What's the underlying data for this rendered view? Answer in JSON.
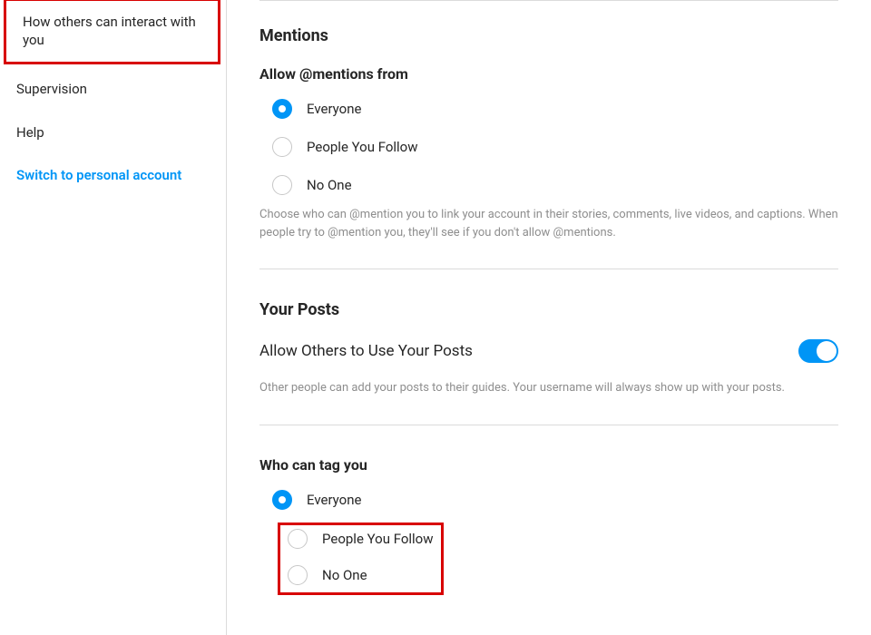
{
  "sidebar": {
    "items": [
      {
        "label": "How others can interact with you"
      },
      {
        "label": "Supervision"
      },
      {
        "label": "Help"
      },
      {
        "label": "Switch to personal account"
      }
    ]
  },
  "mentions": {
    "heading": "Mentions",
    "subheading": "Allow @mentions from",
    "options": [
      {
        "label": "Everyone",
        "selected": true
      },
      {
        "label": "People You Follow",
        "selected": false
      },
      {
        "label": "No One",
        "selected": false
      }
    ],
    "help": "Choose who can @mention you to link your account in their stories, comments, live videos, and captions. When people try to @mention you, they'll see if you don't allow @mentions."
  },
  "posts": {
    "heading": "Your Posts",
    "toggle_label": "Allow Others to Use Your Posts",
    "toggle_on": true,
    "help": "Other people can add your posts to their guides. Your username will always show up with your posts."
  },
  "tag": {
    "heading": "Who can tag you",
    "options": [
      {
        "label": "Everyone",
        "selected": true
      },
      {
        "label": "People You Follow",
        "selected": false
      },
      {
        "label": "No One",
        "selected": false
      }
    ]
  },
  "annotations": {
    "highlight_sidebar_item_index": 0,
    "highlight_tag_options": true
  }
}
